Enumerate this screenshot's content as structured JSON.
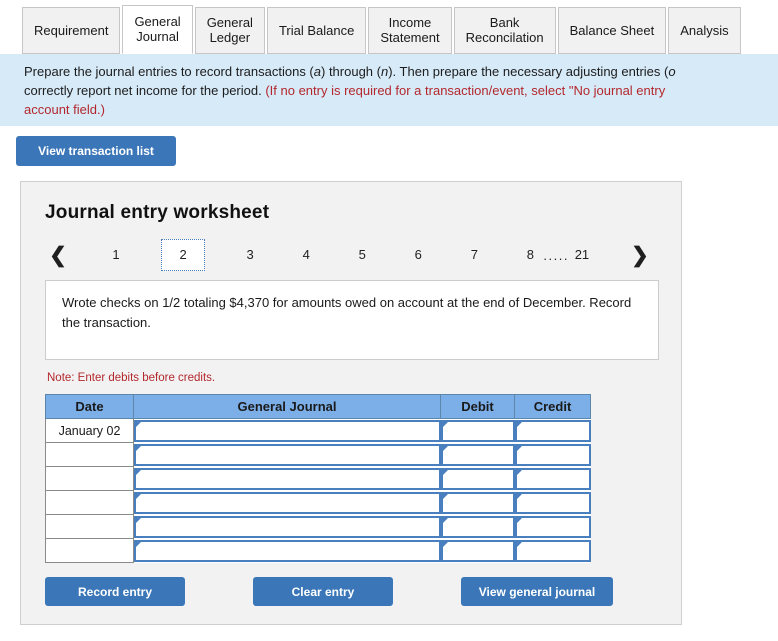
{
  "tabs": [
    {
      "label": "Requirement",
      "active": false
    },
    {
      "label": "General\nJournal",
      "active": true
    },
    {
      "label": "General\nLedger",
      "active": false
    },
    {
      "label": "Trial Balance",
      "active": false
    },
    {
      "label": "Income\nStatement",
      "active": false
    },
    {
      "label": "Bank\nReconcilation",
      "active": false
    },
    {
      "label": "Balance Sheet",
      "active": false
    },
    {
      "label": "Analysis",
      "active": false
    }
  ],
  "banner": {
    "line1_a": "Prepare the journal entries to record transactions (",
    "line1_i1": "a",
    "line1_b": ") through (",
    "line1_i2": "n",
    "line1_c": "). Then prepare the necessary adjusting entries (",
    "line1_i3": "o",
    "line2_a": "correctly report net income for the period. ",
    "line2_red": "(If no entry is required for a transaction/event, select \"No journal entry",
    "line3_red": "account field.)"
  },
  "view_transaction_list_label": "View transaction list",
  "worksheet": {
    "title": "Journal entry worksheet",
    "pager": {
      "prev_icon": "chevron-left-icon",
      "next_icon": "chevron-right-icon",
      "pages": [
        "1",
        "2",
        "3",
        "4",
        "5",
        "6",
        "7",
        "8"
      ],
      "current": "2",
      "ellipsis": ".....",
      "last_page": "21"
    },
    "transaction_text": "Wrote checks on 1/2 totaling $4,370 for amounts owed on account at the end of December. Record the transaction.",
    "note": "Note: Enter debits before credits.",
    "table": {
      "headers": [
        "Date",
        "General Journal",
        "Debit",
        "Credit"
      ],
      "rows": [
        {
          "date": "January 02",
          "general_journal": "",
          "debit": "",
          "credit": ""
        },
        {
          "date": "",
          "general_journal": "",
          "debit": "",
          "credit": ""
        },
        {
          "date": "",
          "general_journal": "",
          "debit": "",
          "credit": ""
        },
        {
          "date": "",
          "general_journal": "",
          "debit": "",
          "credit": ""
        },
        {
          "date": "",
          "general_journal": "",
          "debit": "",
          "credit": ""
        },
        {
          "date": "",
          "general_journal": "",
          "debit": "",
          "credit": ""
        }
      ]
    },
    "buttons": {
      "record_entry": "Record entry",
      "clear_entry": "Clear entry",
      "view_general_journal": "View general journal"
    }
  },
  "colors": {
    "button_blue": "#3b77b8",
    "table_header_blue": "#7cafe8",
    "banner_blue": "#d7eaf8",
    "panel_gray": "#f2f2f2",
    "red_text": "#b3282d",
    "input_border_blue": "#4a7fbf"
  }
}
